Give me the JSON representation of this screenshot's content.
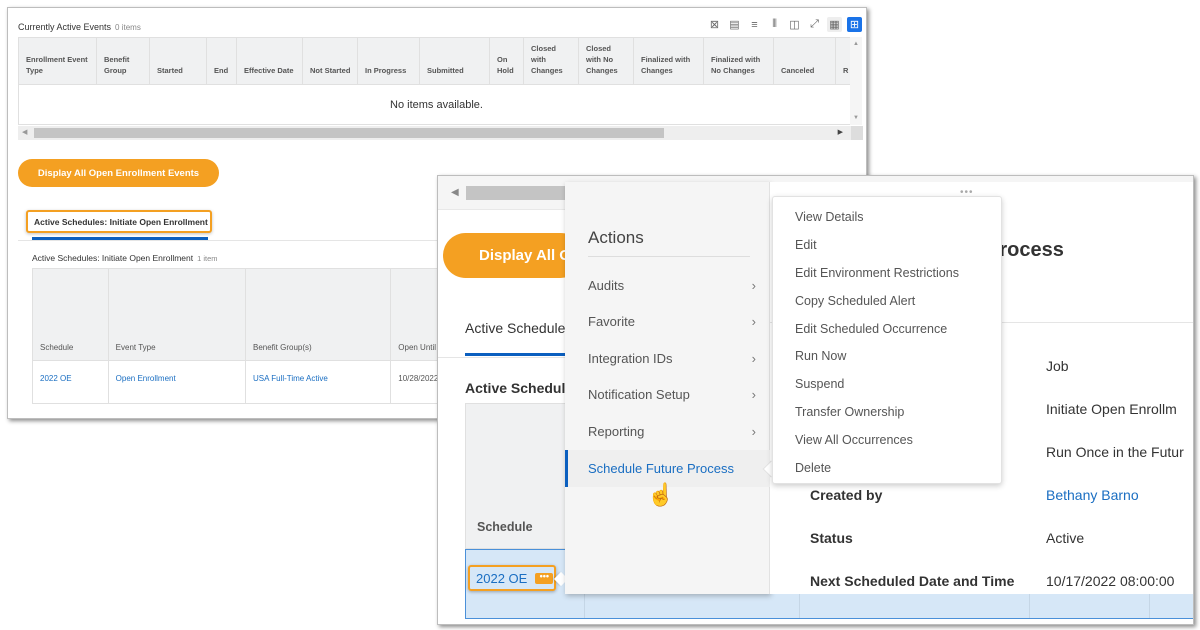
{
  "back_panel": {
    "grid_title": "Currently Active Events",
    "grid_count": "0 items",
    "toolbar_icons": [
      "export-excel-icon",
      "export-pdf-icon",
      "filter-icon",
      "chart-icon",
      "column-chooser-icon",
      "fullscreen-icon",
      "table-view-icon",
      "grid-view-icon"
    ],
    "columns": [
      "Enrollment Event Type",
      "Benefit Group",
      "Started",
      "End",
      "Effective Date",
      "Not Started",
      "In Progress",
      "Submitted",
      "On Hold",
      "Closed with Changes",
      "Closed with No Changes",
      "Finalized with Changes",
      "Finalized with No Changes",
      "Canceled",
      "R"
    ],
    "empty_message": "No items available.",
    "display_button": "Display All Open Enrollment Events",
    "tab_label": "Active Schedules: Initiate Open Enrollment",
    "sub_title": "Active Schedules: Initiate Open Enrollment",
    "sub_count": "1 item",
    "schedule_columns": [
      "Schedule",
      "Event Type",
      "Benefit Group(s)",
      "Open Until"
    ],
    "schedule_rows": [
      {
        "schedule": "2022 OE",
        "event_type": "Open Enrollment",
        "benefit_group": "USA Full-Time Active",
        "open_until": "10/28/2022"
      }
    ]
  },
  "front_panel": {
    "display_button": "Display All O",
    "tab_label": "Active Schedule",
    "sub_title": "Active Schedule",
    "schedule_header": "Schedule",
    "schedule_link": "2022 OE",
    "dots_label": "•••",
    "actions_menu": {
      "title": "Actions",
      "items": [
        {
          "label": "Audits",
          "chevron": "›"
        },
        {
          "label": "Favorite",
          "chevron": "›"
        },
        {
          "label": "Integration IDs",
          "chevron": "›"
        },
        {
          "label": "Notification Setup",
          "chevron": "›"
        },
        {
          "label": "Reporting",
          "chevron": "›"
        },
        {
          "label": "Schedule Future Process",
          "selected": true
        }
      ]
    },
    "sub_menu": {
      "items": [
        "View Details",
        "Edit",
        "Edit Environment Restrictions",
        "Copy Scheduled Alert",
        "Edit Scheduled Occurrence",
        "Run Now",
        "Suspend",
        "Transfer Ownership",
        "View All Occurrences",
        "Delete"
      ]
    },
    "detail": {
      "dots": "•••",
      "heading": "Process",
      "fields": [
        {
          "label": "",
          "value": "Job"
        },
        {
          "label": "",
          "value": "Initiate Open Enrollm"
        },
        {
          "label": "",
          "value": "Run Once in the Futur"
        },
        {
          "label": "Created by",
          "value": "Bethany Barno",
          "link": true
        },
        {
          "label": "Status",
          "value": "Active"
        },
        {
          "label": "Next Scheduled Date and Time",
          "value": "10/17/2022 08:00:00"
        }
      ]
    }
  },
  "colors": {
    "accent_orange": "#f4a022",
    "link_blue": "#1a6ec2",
    "tab_blue": "#0b5fbf",
    "row_selected": "#d6e7f7"
  }
}
